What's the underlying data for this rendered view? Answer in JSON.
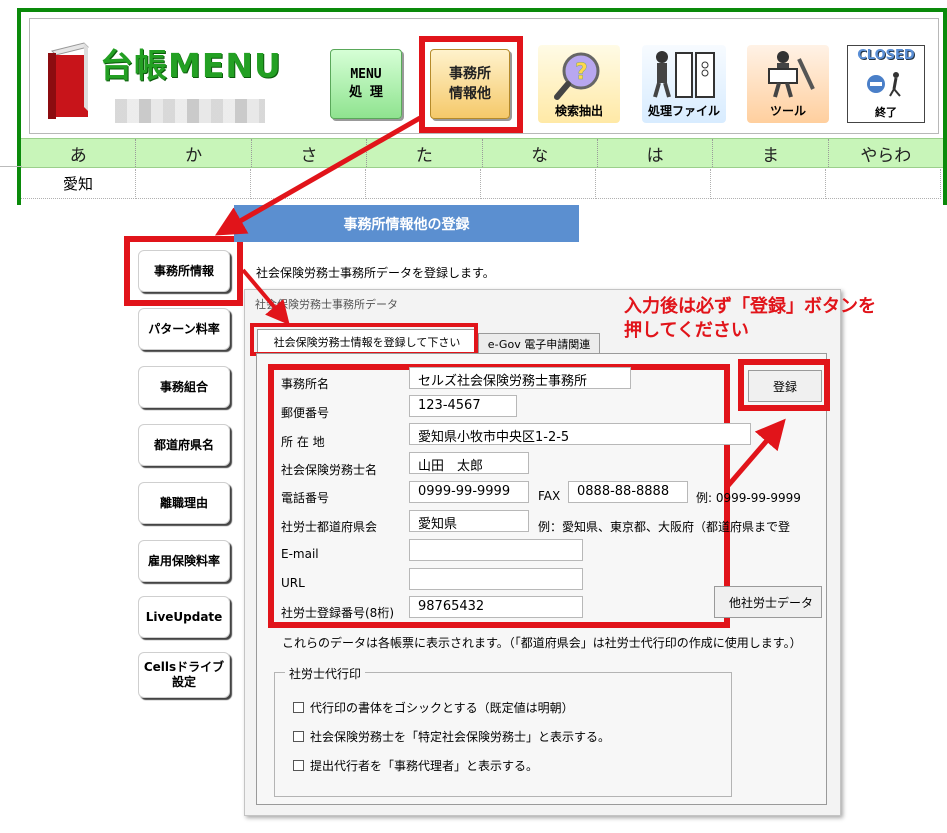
{
  "app": {
    "logo_title": "台帳MENU"
  },
  "toolbar": {
    "menu_label": "MENU\n処 理",
    "office_label": "事務所\n情報他",
    "search_label": "検索抽出",
    "file_label": "処理ファイル",
    "tool_label": "ツール",
    "closed_label": "CLOSED",
    "closed_end_label": "終了"
  },
  "kana_tabs": [
    "あ",
    "か",
    "さ",
    "た",
    "な",
    "は",
    "ま",
    "やらわ"
  ],
  "pref_row": [
    "愛知",
    "",
    "",
    "",
    "",
    "",
    "",
    ""
  ],
  "side_menu": [
    "事務所情報",
    "パターン料率",
    "事務組合",
    "都道府県名",
    "離職理由",
    "雇用保険料率",
    "LiveUpdate",
    "Cellsドライブ\n設定"
  ],
  "registration": {
    "header": "事務所情報他の登録",
    "description": "社会保険労務士事務所データを登録します。"
  },
  "dialog": {
    "title": "社会保険労務士事務所データ",
    "tabs": [
      "社会保険労務士情報を登録して下さい",
      "e-Gov 電子申請関連"
    ],
    "register_button": "登録",
    "other_button": "他社労士データ",
    "fields": {
      "office_name": {
        "label": "事務所名",
        "value": "セルズ社会保険労務士事務所"
      },
      "postal_code": {
        "label": "郵便番号",
        "value": "123-4567"
      },
      "address": {
        "label": "所 在 地",
        "value": "愛知県小牧市中央区1-2-5"
      },
      "sharoushi_name": {
        "label": "社会保険労務士名",
        "value": "山田　太郎"
      },
      "phone": {
        "label": "電話番号",
        "value": "0999-99-9999"
      },
      "fax": {
        "label": "FAX",
        "value": "0888-88-8888"
      },
      "phone_example": "例:  0999-99-9999",
      "prefecture_assoc": {
        "label": "社労士都道府県会",
        "value": "愛知県"
      },
      "prefecture_example": "例：愛知県、東京都、大阪府（都道府県まで登",
      "email": {
        "label": "E-mail",
        "value": ""
      },
      "url": {
        "label": "URL",
        "value": ""
      },
      "reg_number": {
        "label": "社労士登録番号(8桁)",
        "value": "98765432"
      }
    },
    "display_note": "これらのデータは各帳票に表示されます。（「都道府県会」は社労士代行印の作成に使用します。）",
    "proxy_group": {
      "legend": "社労士代行印",
      "options": [
        {
          "label": "代行印の書体をゴシックとする（既定値は明朝）",
          "checked": false
        },
        {
          "label": "社会保険労務士を「特定社会保険労務士」と表示する。",
          "checked": false
        },
        {
          "label": "提出代行者を「事務代理者」と表示する。",
          "checked": false
        }
      ]
    }
  },
  "instruction": "入力後は必ず「登録」ボタンを\n押してください",
  "colors": {
    "accent_red": "#e1141a",
    "frame_green": "#0a8a0a",
    "kana_green": "#c8f5b9",
    "header_blue": "#5b8fd0"
  }
}
